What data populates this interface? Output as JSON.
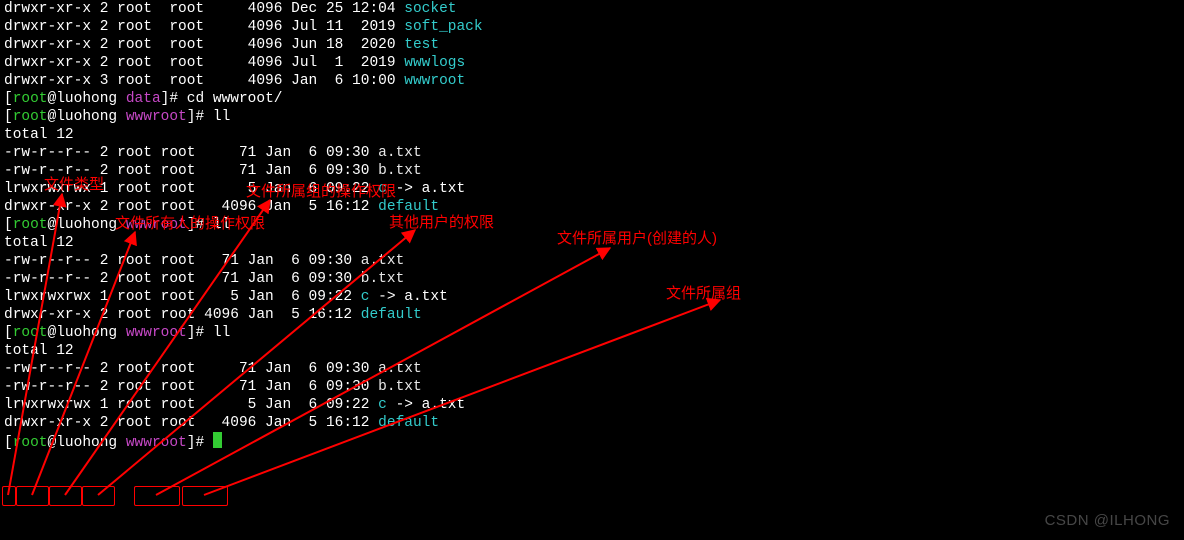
{
  "top_listing": [
    {
      "perm": "drwxr-xr-x",
      "ln": "2",
      "u": "root",
      "g": "root",
      "sz": "4096",
      "dt": "Dec 25 12:04",
      "name": "socket"
    },
    {
      "perm": "drwxr-xr-x",
      "ln": "2",
      "u": "root",
      "g": "root",
      "sz": "4096",
      "dt": "Jul 11  2019",
      "name": "soft_pack"
    },
    {
      "perm": "drwxr-xr-x",
      "ln": "2",
      "u": "root",
      "g": "root",
      "sz": "4096",
      "dt": "Jun 18  2020",
      "name": "test"
    },
    {
      "perm": "drwxr-xr-x",
      "ln": "2",
      "u": "root",
      "g": "root",
      "sz": "4096",
      "dt": "Jul  1  2019",
      "name": "wwwlogs"
    },
    {
      "perm": "drwxr-xr-x",
      "ln": "3",
      "u": "root",
      "g": "root",
      "sz": "4096",
      "dt": "Jan  6 10:00",
      "name": "wwwroot"
    }
  ],
  "prompt": {
    "user": "root",
    "host": "@luohong ",
    "sep": "]# ",
    "dir1": "data",
    "dir2": "wwwroot",
    "cmd_cd": "cd wwwroot/",
    "cmd_ll": "ll"
  },
  "total": "total 12",
  "ww_listing": [
    {
      "perm": "-rw-r--r--",
      "ln": "2",
      "u": "root",
      "g": "root",
      "sz": "71",
      "dt": "Jan  6 09:30",
      "name": "a.txt"
    },
    {
      "perm": "-rw-r--r--",
      "ln": "2",
      "u": "root",
      "g": "root",
      "sz": "71",
      "dt": "Jan  6 09:30",
      "name": "b.txt"
    },
    {
      "perm": "lrwxrwxrwx",
      "ln": "1",
      "u": "root",
      "g": "root",
      "sz": "5",
      "dt": "Jan  6 09:22",
      "name": "c",
      "link": true,
      "target": "a.txt"
    },
    {
      "perm": "drwxr-xr-x",
      "ln": "2",
      "u": "root",
      "g": "root",
      "sz": "4096",
      "dt": "Jan  5 16:12",
      "name": "default"
    }
  ],
  "annotations": {
    "a1": "文件类型",
    "a2": "文件所有人的操作权限",
    "a3": "文件所属组的操作权限",
    "a4": "其他用户的权限",
    "a5": "文件所属用户(创建的人)",
    "a6": "文件所属组"
  },
  "watermark": "CSDN @ILHONG"
}
